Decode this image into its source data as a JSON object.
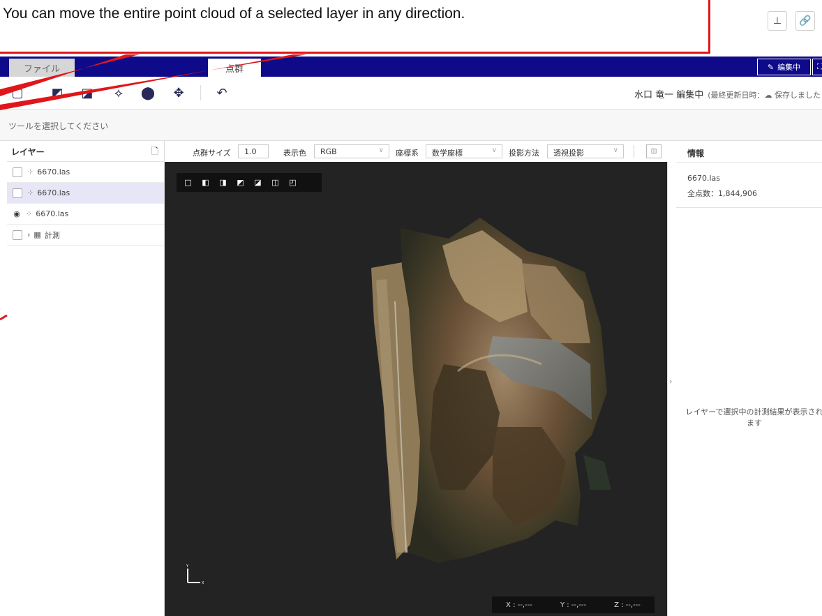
{
  "callout": {
    "text": "You can move the entire point cloud of a selected layer in any direction."
  },
  "tabs": [
    {
      "label": "ファイル"
    },
    {
      "label": "点群"
    }
  ],
  "header": {
    "editing_label": "編集中",
    "user": "水口 竜一 編集中",
    "save_status": "(最終更新日時：☁ 保存しました"
  },
  "hint": "ツールを選択してください",
  "layers": {
    "title": "レイヤー",
    "items": [
      {
        "label": "6670.las",
        "selected": false,
        "visible": false
      },
      {
        "label": "6670.las",
        "selected": true,
        "visible": false
      },
      {
        "label": "6670.las",
        "selected": false,
        "visible": true
      },
      {
        "label": "計測",
        "selected": false,
        "visible": false
      }
    ]
  },
  "viewer": {
    "point_size_label": "点群サイズ",
    "point_size_value": "1.0",
    "color_label": "表示色",
    "color_value": "RGB",
    "coord_label": "座標系",
    "coord_value": "数学座標",
    "projection_label": "投影方法",
    "projection_value": "透視投影",
    "coords": {
      "x": "X : --,---",
      "y": "Y : --,---",
      "z": "Z : --,---"
    }
  },
  "info": {
    "title": "情報",
    "file": "6670.las",
    "count": "全点数：1,844,906",
    "empty_message": "レイヤーで選択中の計測結果が表示されます"
  },
  "colors": {
    "tabbar": "#0e0a8a",
    "callout_border": "#e0161a",
    "viewport_bg": "#232323"
  }
}
